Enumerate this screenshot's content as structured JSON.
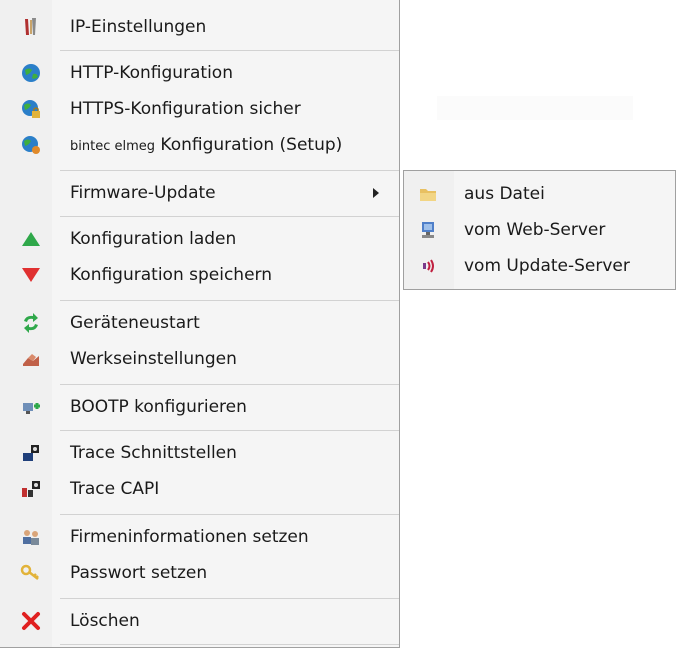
{
  "menu": {
    "items": [
      {
        "label": "IP-Einstellungen",
        "icon": "tools-icon"
      },
      {
        "label": "HTTP-Konfiguration",
        "icon": "globe-icon"
      },
      {
        "label": "HTTPS-Konfiguration sicher",
        "icon": "secure-globe-icon"
      },
      {
        "label_small": "bintec elmeg",
        "label": " Konfiguration (Setup)",
        "icon": "setup-globe-icon"
      },
      {
        "label": "Firmware-Update",
        "icon": "none"
      },
      {
        "label": "Konfiguration laden",
        "icon": "green-up-triangle-icon"
      },
      {
        "label": "Konfiguration speichern",
        "icon": "red-down-triangle-icon"
      },
      {
        "label": "Geräteneustart",
        "icon": "refresh-icon"
      },
      {
        "label": "Werkseinstellungen",
        "icon": "factory-reset-icon"
      },
      {
        "label": "BOOTP konfigurieren",
        "icon": "bootp-icon"
      },
      {
        "label": "Trace Schnittstellen",
        "icon": "trace-interfaces-icon"
      },
      {
        "label": "Trace CAPI",
        "icon": "trace-capi-icon"
      },
      {
        "label": "Firmeninformationen setzen",
        "icon": "company-info-icon"
      },
      {
        "label": "Passwort setzen",
        "icon": "key-icon"
      },
      {
        "label": "Löschen",
        "icon": "red-x-icon"
      }
    ]
  },
  "submenu": {
    "items": [
      {
        "label": "aus Datei",
        "icon": "folder-icon"
      },
      {
        "label": "vom Web-Server",
        "icon": "web-server-icon"
      },
      {
        "label": "vom Update-Server",
        "icon": "update-server-icon"
      }
    ]
  },
  "colors": {
    "menu_bg": "#f5f5f5",
    "separator": "#d2d2d2",
    "border": "#a0a0a0"
  }
}
